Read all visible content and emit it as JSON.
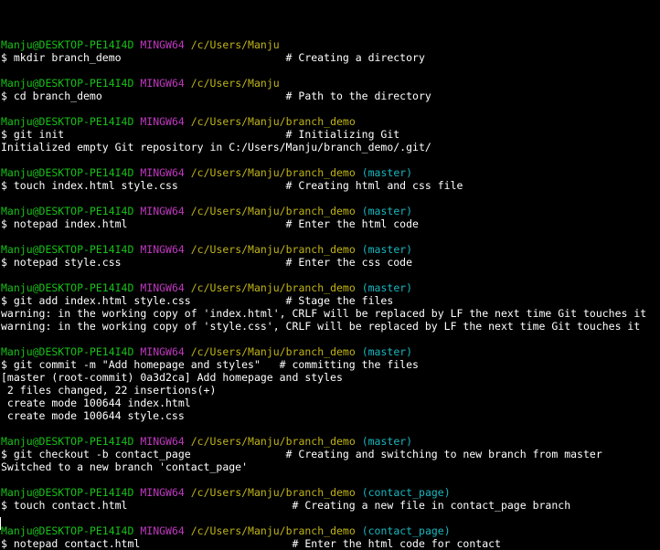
{
  "colors": {
    "background": "#000000",
    "user": "#18c018",
    "system": "#c038c0",
    "path": "#c0b418",
    "branch": "#18b8c0",
    "text": "#ffffff"
  },
  "entries": [
    {
      "prompt": {
        "user": "Manju@DESKTOP-PE14I4D",
        "system": "MINGW64",
        "path": "/c/Users/Manju",
        "branch": ""
      },
      "command": "$ mkdir branch_demo                          # Creating a directory",
      "output": []
    },
    {
      "prompt": {
        "user": "Manju@DESKTOP-PE14I4D",
        "system": "MINGW64",
        "path": "/c/Users/Manju",
        "branch": ""
      },
      "command": "$ cd branch_demo                             # Path to the directory",
      "output": []
    },
    {
      "prompt": {
        "user": "Manju@DESKTOP-PE14I4D",
        "system": "MINGW64",
        "path": "/c/Users/Manju/branch_demo",
        "branch": ""
      },
      "command": "$ git init                                   # Initializing Git",
      "output": [
        "Initialized empty Git repository in C:/Users/Manju/branch_demo/.git/"
      ]
    },
    {
      "prompt": {
        "user": "Manju@DESKTOP-PE14I4D",
        "system": "MINGW64",
        "path": "/c/Users/Manju/branch_demo",
        "branch": "(master)"
      },
      "command": "$ touch index.html style.css                 # Creating html and css file",
      "output": []
    },
    {
      "prompt": {
        "user": "Manju@DESKTOP-PE14I4D",
        "system": "MINGW64",
        "path": "/c/Users/Manju/branch_demo",
        "branch": "(master)"
      },
      "command": "$ notepad index.html                         # Enter the html code",
      "output": []
    },
    {
      "prompt": {
        "user": "Manju@DESKTOP-PE14I4D",
        "system": "MINGW64",
        "path": "/c/Users/Manju/branch_demo",
        "branch": "(master)"
      },
      "command": "$ notepad style.css                          # Enter the css code",
      "output": []
    },
    {
      "prompt": {
        "user": "Manju@DESKTOP-PE14I4D",
        "system": "MINGW64",
        "path": "/c/Users/Manju/branch_demo",
        "branch": "(master)"
      },
      "command": "$ git add index.html style.css               # Stage the files",
      "output": [
        "warning: in the working copy of 'index.html', CRLF will be replaced by LF the next time Git touches it",
        "warning: in the working copy of 'style.css', CRLF will be replaced by LF the next time Git touches it"
      ]
    },
    {
      "prompt": {
        "user": "Manju@DESKTOP-PE14I4D",
        "system": "MINGW64",
        "path": "/c/Users/Manju/branch_demo",
        "branch": "(master)"
      },
      "command": "$ git commit -m \"Add homepage and styles\"   # committing the files",
      "output": [
        "[master (root-commit) 0a3d2ca] Add homepage and styles",
        " 2 files changed, 22 insertions(+)",
        " create mode 100644 index.html",
        " create mode 100644 style.css"
      ]
    },
    {
      "prompt": {
        "user": "Manju@DESKTOP-PE14I4D",
        "system": "MINGW64",
        "path": "/c/Users/Manju/branch_demo",
        "branch": "(master)"
      },
      "command": "$ git checkout -b contact_page               # Creating and switching to new branch from master",
      "output": [
        "Switched to a new branch 'contact_page'"
      ]
    },
    {
      "prompt": {
        "user": "Manju@DESKTOP-PE14I4D",
        "system": "MINGW64",
        "path": "/c/Users/Manju/branch_demo",
        "branch": "(contact_page)"
      },
      "command": "$ touch contact.html                          # Creating a new file in contact_page branch",
      "output": []
    },
    {
      "prompt": {
        "user": "Manju@DESKTOP-PE14I4D",
        "system": "MINGW64",
        "path": "/c/Users/Manju/branch_demo",
        "branch": "(contact_page)"
      },
      "command": "$ notepad contact.html                        # Enter the html code for contact",
      "output": []
    }
  ]
}
